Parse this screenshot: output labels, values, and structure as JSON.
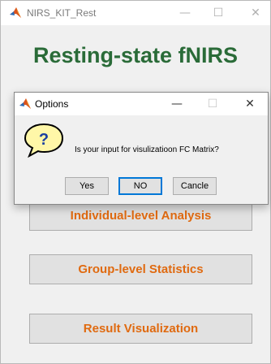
{
  "main_window": {
    "title": "NIRS_KIT_Rest",
    "controls": {
      "minimize": "—",
      "maximize": "☐",
      "close": "✕"
    },
    "heading": "Resting-state fNIRS",
    "buttons": [
      "Individual-level Analysis",
      "Group-level Statistics",
      "Result Visualization"
    ]
  },
  "dialog": {
    "title": "Options",
    "controls": {
      "minimize": "—",
      "maximize": "☐",
      "close": "✕"
    },
    "message": "Is your input for visulizatioon FC Matrix?",
    "buttons": {
      "yes": "Yes",
      "no": "NO",
      "cancel": "Cancle"
    }
  },
  "colors": {
    "heading": "#2a6b38",
    "button_text": "#e06a10",
    "focus_border": "#0078d7",
    "question_icon_fill": "#fff7a8"
  },
  "icons": {
    "app": "matlab-logo-icon",
    "dialog": "matlab-logo-icon",
    "question": "question-bubble-icon"
  }
}
